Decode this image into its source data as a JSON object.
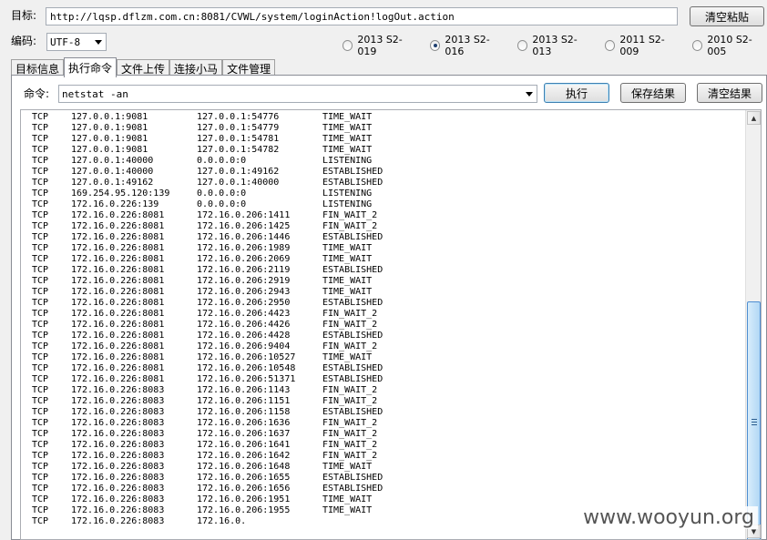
{
  "target": {
    "label": "目标:",
    "url": "http://lqsp.dflzm.com.cn:8081/CVWL/system/loginAction!logOut.action",
    "clear_paste_label": "清空粘贴"
  },
  "encoding": {
    "label": "编码:",
    "value": "UTF-8"
  },
  "exploits": [
    {
      "label": "2013 S2-019",
      "selected": false
    },
    {
      "label": "2013 S2-016",
      "selected": true
    },
    {
      "label": "2013 S2-013",
      "selected": false
    },
    {
      "label": "2011 S2-009",
      "selected": false
    },
    {
      "label": "2010 S2-005",
      "selected": false
    }
  ],
  "tabs": [
    {
      "label": "目标信息",
      "active": false
    },
    {
      "label": "执行命令",
      "active": true
    },
    {
      "label": "文件上传",
      "active": false
    },
    {
      "label": "连接小马",
      "active": false
    },
    {
      "label": "文件管理",
      "active": false
    }
  ],
  "command": {
    "label": "命令:",
    "value": "netstat -an",
    "execute_label": "执行",
    "save_label": "保存结果",
    "clear_label": "清空结果"
  },
  "output_lines": [
    [
      "TCP",
      "127.0.0.1:9081",
      "127.0.0.1:54776",
      "TIME_WAIT"
    ],
    [
      "TCP",
      "127.0.0.1:9081",
      "127.0.0.1:54779",
      "TIME_WAIT"
    ],
    [
      "TCP",
      "127.0.0.1:9081",
      "127.0.0.1:54781",
      "TIME_WAIT"
    ],
    [
      "TCP",
      "127.0.0.1:9081",
      "127.0.0.1:54782",
      "TIME_WAIT"
    ],
    [
      "TCP",
      "127.0.0.1:40000",
      "0.0.0.0:0",
      "LISTENING"
    ],
    [
      "TCP",
      "127.0.0.1:40000",
      "127.0.0.1:49162",
      "ESTABLISHED"
    ],
    [
      "TCP",
      "127.0.0.1:49162",
      "127.0.0.1:40000",
      "ESTABLISHED"
    ],
    [
      "TCP",
      "169.254.95.120:139",
      "0.0.0.0:0",
      "LISTENING"
    ],
    [
      "TCP",
      "172.16.0.226:139",
      "0.0.0.0:0",
      "LISTENING"
    ],
    [
      "TCP",
      "172.16.0.226:8081",
      "172.16.0.206:1411",
      "FIN_WAIT_2"
    ],
    [
      "TCP",
      "172.16.0.226:8081",
      "172.16.0.206:1425",
      "FIN_WAIT_2"
    ],
    [
      "TCP",
      "172.16.0.226:8081",
      "172.16.0.206:1446",
      "ESTABLISHED"
    ],
    [
      "TCP",
      "172.16.0.226:8081",
      "172.16.0.206:1989",
      "TIME_WAIT"
    ],
    [
      "TCP",
      "172.16.0.226:8081",
      "172.16.0.206:2069",
      "TIME_WAIT"
    ],
    [
      "TCP",
      "172.16.0.226:8081",
      "172.16.0.206:2119",
      "ESTABLISHED"
    ],
    [
      "TCP",
      "172.16.0.226:8081",
      "172.16.0.206:2919",
      "TIME_WAIT"
    ],
    [
      "TCP",
      "172.16.0.226:8081",
      "172.16.0.206:2943",
      "TIME_WAIT"
    ],
    [
      "TCP",
      "172.16.0.226:8081",
      "172.16.0.206:2950",
      "ESTABLISHED"
    ],
    [
      "TCP",
      "172.16.0.226:8081",
      "172.16.0.206:4423",
      "FIN_WAIT_2"
    ],
    [
      "TCP",
      "172.16.0.226:8081",
      "172.16.0.206:4426",
      "FIN_WAIT_2"
    ],
    [
      "TCP",
      "172.16.0.226:8081",
      "172.16.0.206:4428",
      "ESTABLISHED"
    ],
    [
      "TCP",
      "172.16.0.226:8081",
      "172.16.0.206:9404",
      "FIN_WAIT_2"
    ],
    [
      "TCP",
      "172.16.0.226:8081",
      "172.16.0.206:10527",
      "TIME_WAIT"
    ],
    [
      "TCP",
      "172.16.0.226:8081",
      "172.16.0.206:10548",
      "ESTABLISHED"
    ],
    [
      "TCP",
      "172.16.0.226:8081",
      "172.16.0.206:51371",
      "ESTABLISHED"
    ],
    [
      "TCP",
      "172.16.0.226:8083",
      "172.16.0.206:1143",
      "FIN_WAIT_2"
    ],
    [
      "TCP",
      "172.16.0.226:8083",
      "172.16.0.206:1151",
      "FIN_WAIT_2"
    ],
    [
      "TCP",
      "172.16.0.226:8083",
      "172.16.0.206:1158",
      "ESTABLISHED"
    ],
    [
      "TCP",
      "172.16.0.226:8083",
      "172.16.0.206:1636",
      "FIN_WAIT_2"
    ],
    [
      "TCP",
      "172.16.0.226:8083",
      "172.16.0.206:1637",
      "FIN_WAIT_2"
    ],
    [
      "TCP",
      "172.16.0.226:8083",
      "172.16.0.206:1641",
      "FIN_WAIT_2"
    ],
    [
      "TCP",
      "172.16.0.226:8083",
      "172.16.0.206:1642",
      "FIN_WAIT_2"
    ],
    [
      "TCP",
      "172.16.0.226:8083",
      "172.16.0.206:1648",
      "TIME_WAIT"
    ],
    [
      "TCP",
      "172.16.0.226:8083",
      "172.16.0.206:1655",
      "ESTABLISHED"
    ],
    [
      "TCP",
      "172.16.0.226:8083",
      "172.16.0.206:1656",
      "ESTABLISHED"
    ],
    [
      "TCP",
      "172.16.0.226:8083",
      "172.16.0.206:1951",
      "TIME_WAIT"
    ],
    [
      "TCP",
      "172.16.0.226:8083",
      "172.16.0.206:1955",
      "TIME_WAIT"
    ],
    [
      "TCP",
      "172.16.0.226:8083",
      "172.16.0.",
      ""
    ]
  ],
  "scrollbar": {
    "up_icon": "▲",
    "down_icon": "▼"
  },
  "watermark": "www.wooyun.org"
}
